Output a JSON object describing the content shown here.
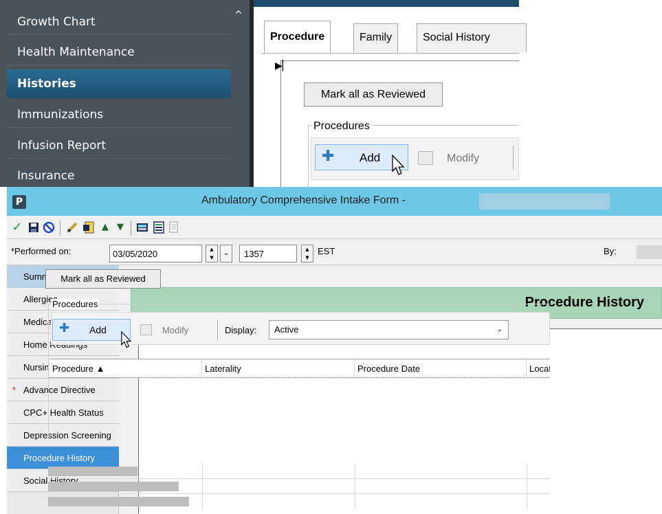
{
  "back_window": {
    "sidebar": {
      "items": [
        {
          "label": "Growth Chart"
        },
        {
          "label": "Health Maintenance"
        },
        {
          "label": "Histories"
        },
        {
          "label": "Immunizations"
        },
        {
          "label": "Infusion Report"
        },
        {
          "label": "Insurance"
        }
      ],
      "active_index": 2,
      "scroll_up": "^"
    },
    "tabs": [
      {
        "label": "Procedure"
      },
      {
        "label": "Family"
      },
      {
        "label": "Social History"
      }
    ],
    "active_tab": 0,
    "mark_all_label": "Mark all as Reviewed",
    "group_label": "Procedures",
    "add_label": "Add",
    "modify_label": "Modify"
  },
  "window": {
    "app_icon": "P",
    "title": "Ambulatory Comprehensive Intake Form -",
    "title_color": "#6cc8e4"
  },
  "toolbar_icons": [
    "checkmark-icon",
    "save-icon",
    "cancel-icon",
    "pen-icon",
    "form-icon",
    "arrow-up-icon",
    "arrow-down-icon",
    "calculator-icon",
    "list-icon",
    "document-icon"
  ],
  "performed": {
    "label": "*Performed on:",
    "date": "03/05/2020",
    "time": "1357",
    "timezone": "EST",
    "by_label": "By:"
  },
  "nav": {
    "items": [
      {
        "label": "Summary",
        "required": false
      },
      {
        "label": "Allergies",
        "required": false
      },
      {
        "label": "Medication List",
        "required": false
      },
      {
        "label": "Home Readings",
        "required": false
      },
      {
        "label": "Nursing HPI",
        "required": false
      },
      {
        "label": "Advance Directive",
        "required": true
      },
      {
        "label": "CPC+ Health Status",
        "required": false
      },
      {
        "label": "Depression Screening",
        "required": false
      },
      {
        "label": "Procedure History",
        "required": false
      },
      {
        "label": "Social History",
        "required": false
      }
    ],
    "active_index": 8,
    "required_marker": "*"
  },
  "main": {
    "banner_title": "Procedure History",
    "banner_color": "#a8d5b8",
    "mark_all_label": "Mark all as Reviewed",
    "group_label": "Procedures",
    "add_label": "Add",
    "modify_label": "Modify",
    "display_label": "Display:",
    "display_value": "Active",
    "columns": [
      "Procedure ▲",
      "Laterality",
      "Procedure Date",
      "Location"
    ]
  }
}
